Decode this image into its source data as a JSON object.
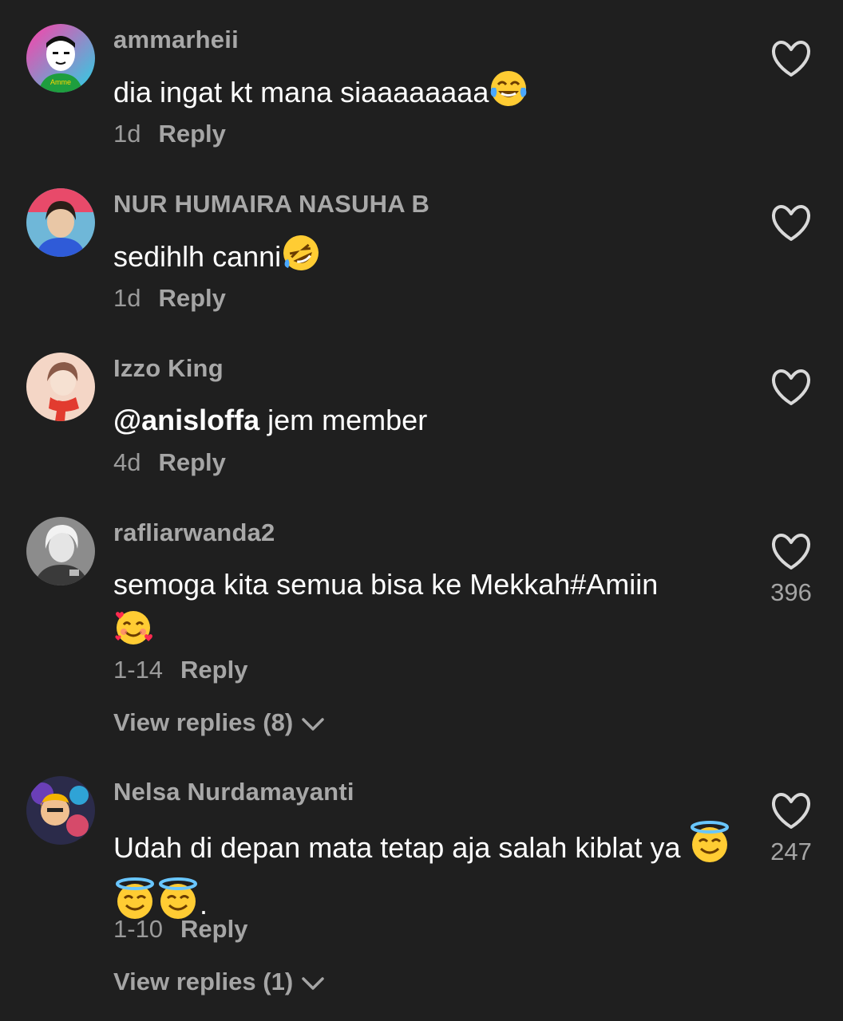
{
  "comments": [
    {
      "username": "ammarheii",
      "text": "dia ingat kt mana siaaaaaaaa",
      "emoji": "face-with-tears-of-joy",
      "date": "1d",
      "reply_label": "Reply",
      "likes": ""
    },
    {
      "username": "NUR HUMAIRA NASUHA B",
      "text": "sedihlh canni",
      "emoji": "rolling-on-floor-laughing",
      "date": "1d",
      "reply_label": "Reply",
      "likes": ""
    },
    {
      "username": "Izzo King",
      "mention": "@anisloffa",
      "text": " jem member",
      "date": "4d",
      "reply_label": "Reply",
      "likes": ""
    },
    {
      "username": "rafliarwanda2",
      "text": "semoga kita semua bisa ke Mekkah#Amiin",
      "emoji": "smiling-face-with-hearts",
      "date": "1-14",
      "reply_label": "Reply",
      "likes": "396",
      "view_replies": "View replies (8)"
    },
    {
      "username": "Nelsa Nurdamayanti",
      "text": "Udah di depan mata tetap aja salah kiblat ya ",
      "emoji": "smiling-face-with-halo",
      "text_end": ".",
      "date": "1-10",
      "reply_label": "Reply",
      "likes": "247",
      "view_replies": "View replies (1)"
    }
  ],
  "colors": {
    "background": "#1f1f1f",
    "username": "#a8a8a8",
    "text": "#ffffff",
    "meta": "#9b9b9b"
  }
}
